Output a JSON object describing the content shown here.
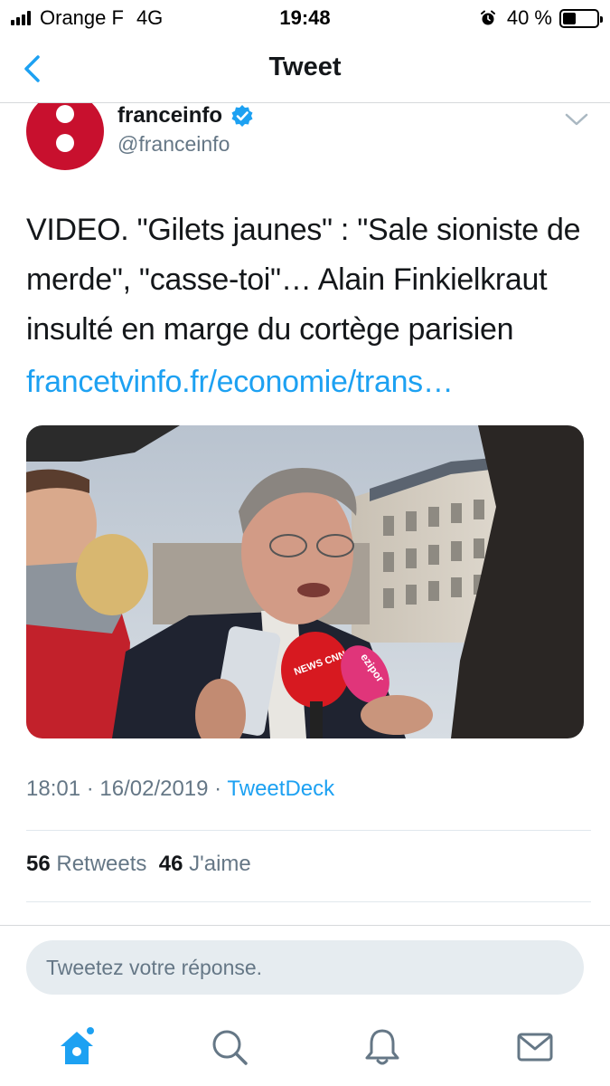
{
  "status_bar": {
    "carrier": "Orange F",
    "network": "4G",
    "time": "19:48",
    "battery": "40 %",
    "battery_level": 0.4
  },
  "nav": {
    "title": "Tweet"
  },
  "tweet": {
    "author_name": "franceinfo",
    "author_handle": "@franceinfo",
    "text": "VIDEO. \"Gilets jaunes\" : \"Sale sioniste de merde\", \"casse-toi\"… Alain Finkielkraut insulté en marge du cortège parisien",
    "link": "francetvinfo.fr/economie/trans…",
    "time_date": "18:01 · 16/02/2019 · ",
    "source": "TweetDeck",
    "retweets_count": "56",
    "retweets_label": "Retweets",
    "likes_count": "46",
    "likes_label": "J'aime",
    "media_badges": [
      "NEWS",
      "CNN",
      "ezipor"
    ]
  },
  "reply": {
    "placeholder": "Tweetez votre réponse."
  },
  "colors": {
    "accent": "#1da1f2",
    "avatar_red": "#c8102e",
    "muted": "#657786"
  },
  "icons": [
    "back-icon",
    "verified-icon",
    "chevron-down-icon",
    "home-icon",
    "search-icon",
    "bell-icon",
    "mail-icon"
  ]
}
